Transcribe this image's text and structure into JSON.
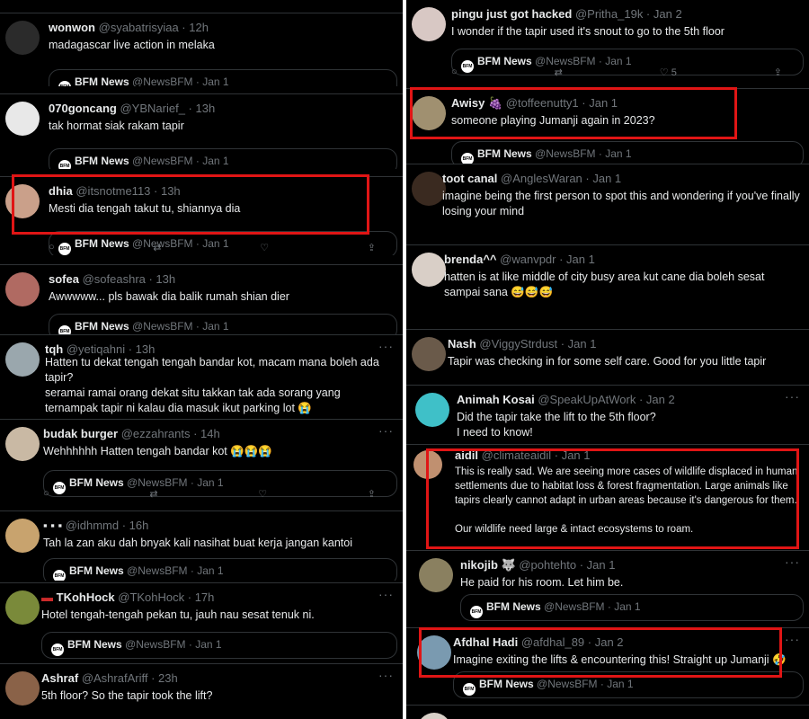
{
  "quoted": {
    "name": "BFM News",
    "handle": "@NewsBFM",
    "date": "· Jan 1"
  },
  "actions": {
    "reply": "○",
    "retweet": "⇄",
    "like": "♡",
    "like_count": "5",
    "share": "⇪"
  },
  "left": [
    {
      "name": "wonwon",
      "handle": "@syabatrisyiaa · 12h",
      "text": "madagascar live action in melaka"
    },
    {
      "name": "070goncang",
      "handle": "@YBNarief_ · 13h",
      "text": "tak hormat siak rakam tapir"
    },
    {
      "name": "dhia",
      "handle": "@itsnotme113 · 13h",
      "text": "Mesti dia tengah takut tu, shiannya dia"
    },
    {
      "name": "sofea",
      "handle": "@sofeashra · 13h",
      "text": "Awwwww... pls bawak dia balik rumah shian dier"
    },
    {
      "name": "tqh",
      "handle": "@yetiqahni · 13h",
      "text": "Hatten tu dekat tengah tengah bandar kot, macam mana boleh ada tapir?\nseramai ramai orang dekat situ takkan tak ada sorang yang ternampak tapir ni kalau dia masuk ikut parking lot 😭"
    },
    {
      "name": "budak burger",
      "handle": "@ezzahrants · 14h",
      "text": "Wehhhhhh Hatten tengah bandar kot 😭😭😭"
    },
    {
      "name": "▪ ▪ ▪",
      "handle": "@idhmmd · 16h",
      "text": "Tah la zan aku dah bnyak kali nasihat buat kerja jangan kantoi"
    },
    {
      "name": "TKohHock",
      "handle": "@TKohHock · 17h",
      "text": "Hotel tengah-tengah pekan tu, jauh nau sesat tenuk ni."
    },
    {
      "name": "Ashraf",
      "handle": "@AshrafAriff · 23h",
      "text": "5th floor? So the tapir took the lift?"
    }
  ],
  "right": [
    {
      "name": "pingu just got hacked",
      "handle": "@Pritha_19k · Jan 2",
      "text": "I wonder if the tapir used it's snout to go to the 5th floor"
    },
    {
      "name": "Awisy 🍇",
      "handle": "@toffeenutty1 · Jan 1",
      "text": "someone playing Jumanji again in 2023?"
    },
    {
      "name": "toot canal",
      "handle": "@AnglesWaran · Jan 1",
      "text": "imagine being the first person to spot this and wondering if you've finally losing your mind"
    },
    {
      "name": "brenda^^",
      "handle": "@wanvpdr · Jan 1",
      "text": "hatten is at like middle of city busy area kut cane dia boleh sesat sampai sana 😅😅😅"
    },
    {
      "name": "Nash",
      "handle": "@ViggyStrdust · Jan 1",
      "text": "Tapir was checking in for some self care. Good for you little tapir"
    },
    {
      "name": "Animah Kosai",
      "handle": "@SpeakUpAtWork · Jan 2",
      "text": "Did the tapir take the lift to the 5th floor?\nI need to know!"
    },
    {
      "name": "aidil",
      "handle": "@climateaidil · Jan 1",
      "text": "This is really sad. We are seeing more cases of wildlife displaced in human settlements due to habitat loss & forest fragmentation. Large animals like tapirs clearly cannot adapt in urban areas because it's dangerous for them.\n\nOur wildlife need large & intact ecosystems to roam."
    },
    {
      "name": "nikojib 🐺",
      "handle": "@pohtehto · Jan 1",
      "text": "He paid for his room. Let him be."
    },
    {
      "name": "Afdhal Hadi",
      "handle": "@afdhal_89 · Jan 2",
      "text": "Imagine exiting the lifts & encountering this! Straight up Jumanji 🤣"
    }
  ]
}
